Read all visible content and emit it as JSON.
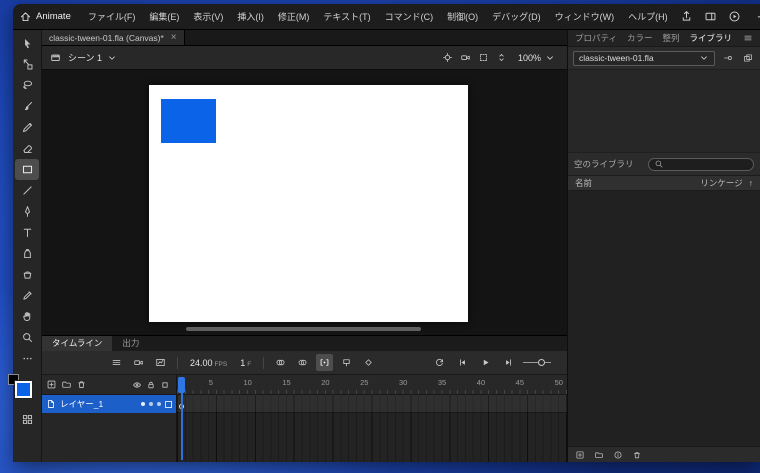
{
  "colors": {
    "accent_blue": "#2e77e5",
    "shape_blue": "#0b63e8",
    "layer_selected_blue": "#1d5fc9",
    "stroke_black": "#000000"
  },
  "titlebar": {
    "app_label": "Animate",
    "menus": [
      "ファイル(F)",
      "編集(E)",
      "表示(V)",
      "挿入(I)",
      "修正(M)",
      "テキスト(T)",
      "コマンド(C)",
      "制御(O)",
      "デバッグ(D)",
      "ウィンドウ(W)",
      "ヘルプ(H)"
    ]
  },
  "document_tab": {
    "title": "classic-tween-01.fla (Canvas)*",
    "close_glyph": "×"
  },
  "edit_bar": {
    "scene_label": "シーン 1",
    "zoom_value": "100%"
  },
  "toolbar": {
    "active_tool": "rectangle",
    "tools": [
      "selection",
      "free-transform",
      "lasso",
      "brush",
      "pencil",
      "eraser",
      "rectangle",
      "line",
      "pen",
      "text",
      "ink-bottle",
      "paint-bucket",
      "eyedropper",
      "hand",
      "zoom",
      "more"
    ]
  },
  "timeline": {
    "tabs": [
      {
        "label": "タイムライン",
        "active": true
      },
      {
        "label": "出力",
        "active": false
      }
    ],
    "fps_value": "24.00",
    "fps_unit": "FPS",
    "current_frame": "1",
    "frame_unit": "F",
    "layers": [
      {
        "name": "レイヤー_1",
        "selected": true
      }
    ],
    "ruler_numbers": [
      "5",
      "10",
      "15",
      "20",
      "25",
      "30",
      "35",
      "40",
      "45",
      "50"
    ]
  },
  "right_panel": {
    "tabs": [
      {
        "label": "プロパティ",
        "active": false
      },
      {
        "label": "カラー",
        "active": false
      },
      {
        "label": "整列",
        "active": false
      },
      {
        "label": "ライブラリ",
        "active": true
      }
    ],
    "library": {
      "document_name": "classic-tween-01.fla",
      "empty_text": "空のライブラリ",
      "search_placeholder": "",
      "name_column": "名前",
      "linkage_column": "リンケージ",
      "sort_glyph": "↑"
    }
  }
}
